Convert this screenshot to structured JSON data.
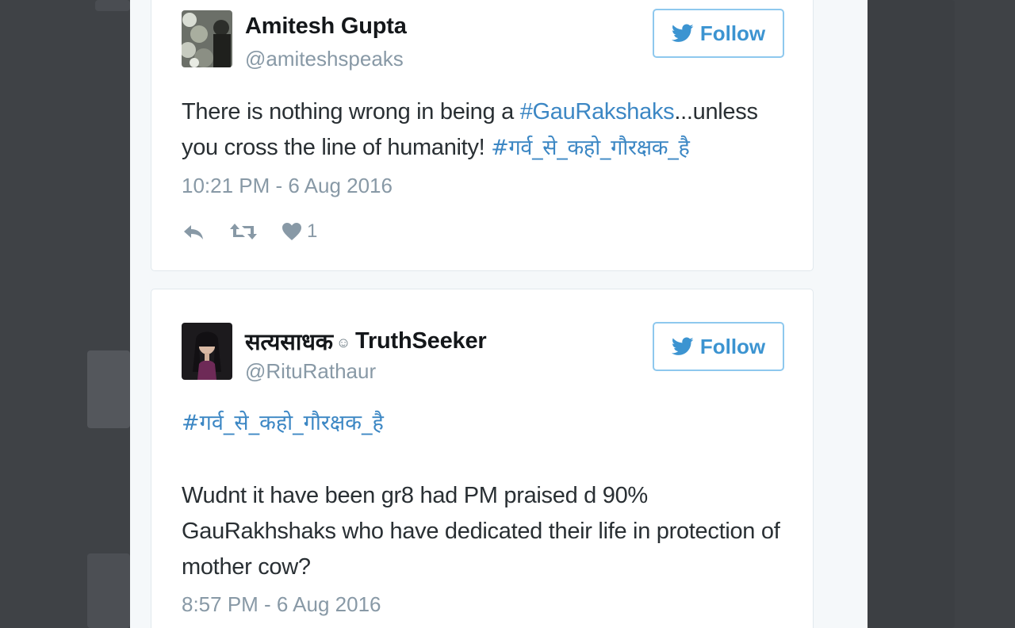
{
  "tweets": [
    {
      "display_name": "Amitesh Gupta",
      "handle": "@amiteshspeaks",
      "follow_label": "Follow",
      "text_before": "There is nothing wrong in being a ",
      "hashtag_1": "#GauRakshaks",
      "text_after": "...unless you cross the line of humanity! ",
      "hashtag_2": "#गर्व_से_कहो_गौरक्षक_है",
      "timestamp": "10:21 PM - 6 Aug 2016",
      "like_count": "1"
    },
    {
      "display_name_hindi": "सत्यसाधक",
      "display_name_emoji": "☺",
      "display_name_en": "TruthSeeker",
      "handle": "@RituRathaur",
      "follow_label": "Follow",
      "hashtag": "#गर्व_से_कहो_गौरक्षक_है",
      "text": "Wudnt it have been gr8 had PM praised d 90% GauRakhshaks who have dedicated their life in protection of mother cow?",
      "timestamp": "8:57 PM - 6 Aug 2016"
    }
  ],
  "colors": {
    "link": "#3c87c4",
    "follow": "#3c94d1",
    "muted": "#8899a6",
    "backdrop": "#3f4246"
  },
  "icons": [
    "twitter-bird-icon",
    "reply-icon",
    "retweet-icon",
    "heart-icon",
    "smiley-icon"
  ]
}
